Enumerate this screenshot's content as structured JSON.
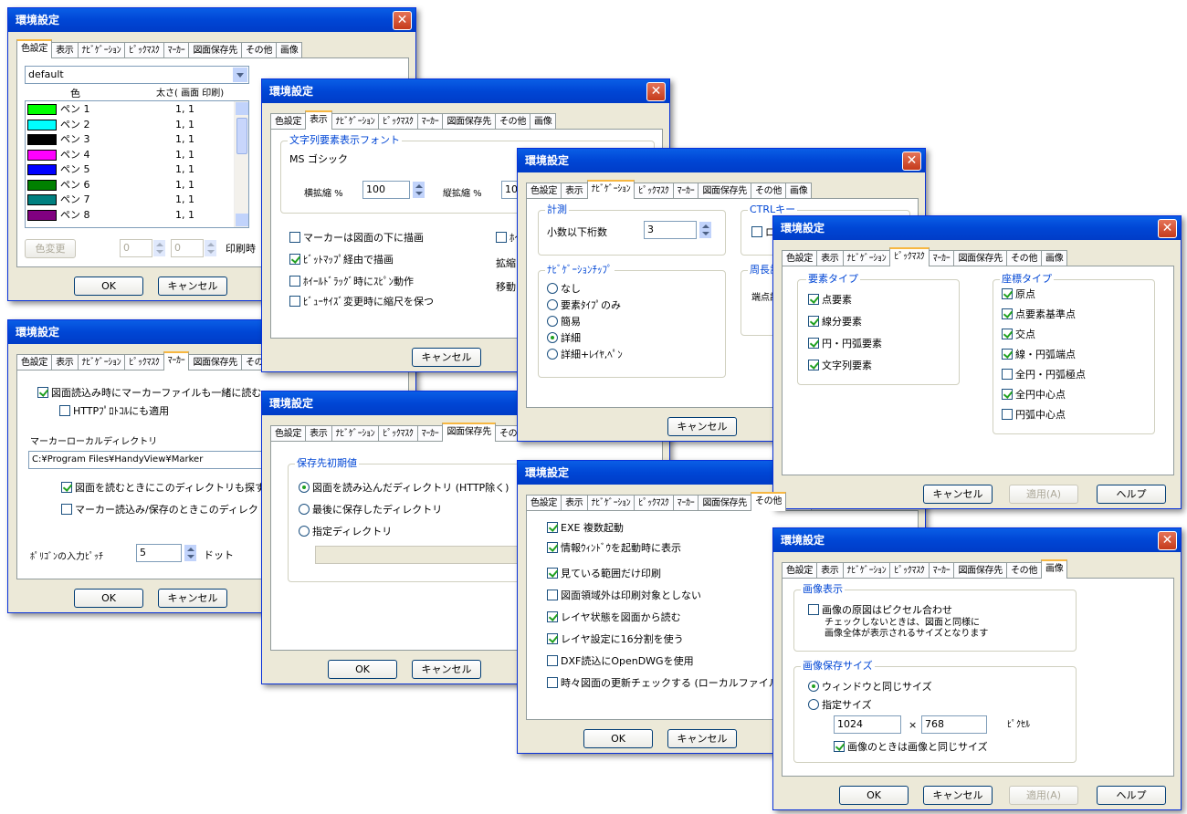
{
  "window_title": "環境設定",
  "tabs": [
    "色設定",
    "表示",
    "ﾅﾋﾞｹﾞｰｼｮﾝ",
    "ﾋﾟｯｸﾏｽｸ",
    "ﾏｰｶｰ",
    "図面保存先",
    "その他",
    "画像"
  ],
  "buttons": {
    "ok": "OK",
    "cancel": "キャンセル",
    "apply": "適用(A)",
    "help": "ヘルプ"
  },
  "color_settings": {
    "scheme": "default",
    "col_color": "色",
    "col_width": "太さ( 画面  印刷)",
    "pens": [
      {
        "name": "ペン 1",
        "color": "#00ff00",
        "width": "1, 1"
      },
      {
        "name": "ペン 2",
        "color": "#00ffff",
        "width": "1, 1"
      },
      {
        "name": "ペン 3",
        "color": "#000000",
        "width": "1, 1"
      },
      {
        "name": "ペン 4",
        "color": "#ff00ff",
        "width": "1, 1"
      },
      {
        "name": "ペン 5",
        "color": "#0000ff",
        "width": "1, 1"
      },
      {
        "name": "ペン 6",
        "color": "#008000",
        "width": "1, 1"
      },
      {
        "name": "ペン 7",
        "color": "#008080",
        "width": "1, 1"
      },
      {
        "name": "ペン 8",
        "color": "#800080",
        "width": "1, 1"
      }
    ],
    "change_color": "色変更",
    "screen_value": "0",
    "print_value": "0",
    "print_label": "印刷時"
  },
  "display": {
    "font_group": "文字列要素表示フォント",
    "font_name": "MS ゴシック",
    "hscale_label": "横拡縮 %",
    "hscale_value": "100",
    "vscale_label": "縦拡縮 %",
    "vscale_value": "10",
    "opt1": "マーカーは図面の下に描画",
    "opt2": "ﾋﾞｯﾄﾏｯﾌﾟ経由で描画",
    "opt3": "ﾎｲｰﾙﾄﾞﾗｯｸﾞ時にｽﾋﾟﾝ動作",
    "opt4": "ﾋﾞｭｰｻｲｽﾞ変更時に縮尺を保つ",
    "right_opt": "ﾎｲ",
    "zoom": "拡縮",
    "move": "移動"
  },
  "navigation": {
    "measure_group": "計測",
    "decimals_label": "小数以下桁数",
    "decimals_value": "3",
    "ctrl_group": "CTRLキー",
    "ctrl_opt": "ロッ",
    "tip_group": "ﾅﾋﾞｹﾞｰｼｮﾝﾁｯﾌﾟ",
    "tips": [
      "なし",
      "要素ﾀｲﾌﾟのみ",
      "簡易",
      "詳細",
      "詳細+ﾚｲﾔ,ﾍﾟﾝ"
    ],
    "periph_group": "周長計",
    "endpoint": "端点許"
  },
  "pickmask": {
    "elem_group": "要素タイプ",
    "elems": [
      "点要素",
      "線分要素",
      "円・円弧要素",
      "文字列要素"
    ],
    "coord_group": "座標タイプ",
    "coords": [
      "原点",
      "点要素基準点",
      "交点",
      "線・円弧端点",
      "全円・円弧極点",
      "全円中心点",
      "円弧中心点"
    ]
  },
  "marker": {
    "opt_load": "図面読込み時にマーカーファイルも一緒に読む",
    "opt_http": "HTTPﾌﾟﾛﾄｺﾙにも適用",
    "dir_label": "マーカーローカルディレクトリ",
    "dir_value": "C:¥Program Files¥HandyView¥Marker",
    "opt_search": "図面を読むときにこのディレクトリも探す",
    "opt_first": "マーカー読込み/保存のときこのディレクトリを最初に",
    "pitch_label": "ﾎﾟﾘｺﾞﾝの入力ﾋﾟｯﾁ",
    "pitch_value": "5",
    "pitch_unit": "ドット"
  },
  "savedir": {
    "group": "保存先初期値",
    "opt1": "図面を読み込んだディレクトリ (HTTP除く)",
    "opt2": "最後に保存したディレクトリ",
    "opt3": "指定ディレクトリ"
  },
  "other": {
    "opts": [
      "EXE 複数起動",
      "情報ｳｨﾝﾄﾞｳを起動時に表示",
      "見ている範囲だけ印刷",
      "図面領域外は印刷対象としない",
      "レイヤ状態を図面から読む",
      "レイヤ設定に16分割を使う",
      "DXF読込にOpenDWGを使用",
      "時々図面の更新チェックする (ローカルファイルのみ)"
    ]
  },
  "image": {
    "display_group": "画像表示",
    "pixel_opt": "画像の原図はピクセル合わせ",
    "note1": "チェックしないときは、図面と同様に",
    "note2": "画像全体が表示されるサイズとなります",
    "size_group": "画像保存サイズ",
    "size_opt1": "ウィンドウと同じサイズ",
    "size_opt2": "指定サイズ",
    "width": "1024",
    "times": "×",
    "height": "768",
    "unit": "ﾋﾟｸｾﾙ",
    "same_opt": "画像のときは画像と同じサイズ"
  }
}
